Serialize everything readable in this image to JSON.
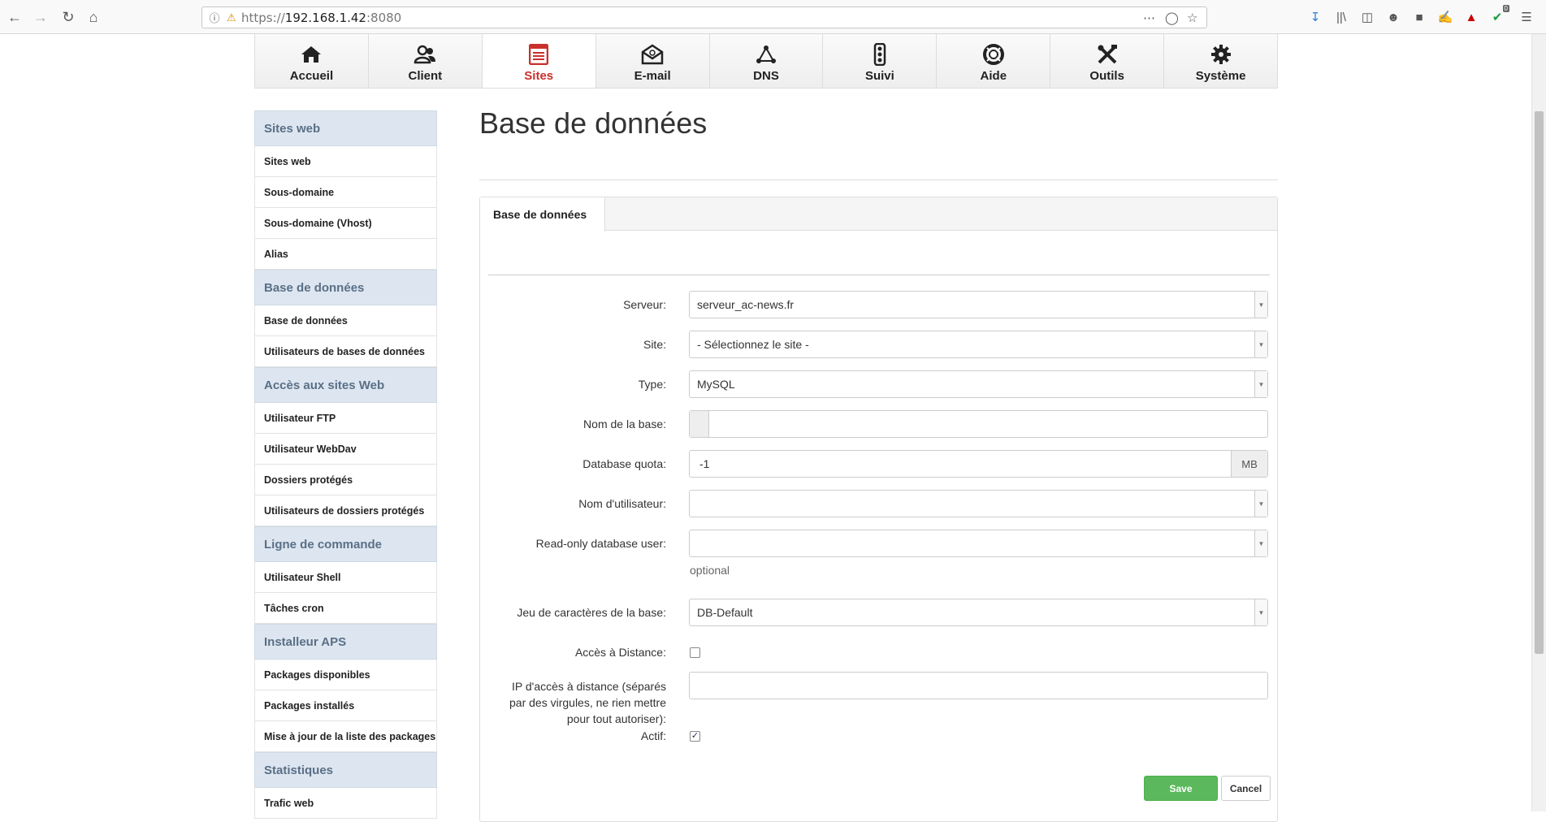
{
  "browser": {
    "url_prefix": "https://",
    "url_host": "192.168.1.42",
    "url_port": ":8080",
    "badge_count": "0"
  },
  "topnav": [
    {
      "label": "Accueil",
      "icon": "home-icon"
    },
    {
      "label": "Client",
      "icon": "users-icon"
    },
    {
      "label": "Sites",
      "icon": "sites-icon",
      "active": true
    },
    {
      "label": "E-mail",
      "icon": "email-icon"
    },
    {
      "label": "DNS",
      "icon": "dns-icon"
    },
    {
      "label": "Suivi",
      "icon": "traffic-light-icon"
    },
    {
      "label": "Aide",
      "icon": "lifebuoy-icon"
    },
    {
      "label": "Outils",
      "icon": "tools-icon"
    },
    {
      "label": "Système",
      "icon": "gear-icon"
    }
  ],
  "sidebar": {
    "sections": [
      {
        "header": "Sites web",
        "items": [
          "Sites web",
          "Sous-domaine",
          "Sous-domaine (Vhost)",
          "Alias"
        ]
      },
      {
        "header": "Base de données",
        "items": [
          "Base de données",
          "Utilisateurs de bases de données"
        ]
      },
      {
        "header": "Accès aux sites Web",
        "items": [
          "Utilisateur FTP",
          "Utilisateur WebDav",
          "Dossiers protégés",
          "Utilisateurs de dossiers protégés"
        ]
      },
      {
        "header": "Ligne de commande",
        "items": [
          "Utilisateur Shell",
          "Tâches cron"
        ]
      },
      {
        "header": "Installeur APS",
        "items": [
          "Packages disponibles",
          "Packages installés",
          "Mise à jour de la liste des packages"
        ]
      },
      {
        "header": "Statistiques",
        "items": [
          "Trafic web"
        ]
      }
    ]
  },
  "main": {
    "title": "Base de données",
    "tab": "Base de données",
    "form": {
      "server_label": "Serveur:",
      "server_value": "serveur_ac-news.fr",
      "site_label": "Site:",
      "site_value": "- Sélectionnez le site -",
      "type_label": "Type:",
      "type_value": "MySQL",
      "dbname_label": "Nom de la base:",
      "dbname_value": "",
      "quota_label": "Database quota:",
      "quota_value": "-1",
      "quota_unit": "MB",
      "user_label": "Nom d'utilisateur:",
      "user_value": "",
      "rouser_label": "Read-only database user:",
      "rouser_value": "",
      "rouser_help": "optional",
      "charset_label": "Jeu de caractères de la base:",
      "charset_value": "DB-Default",
      "remote_label": "Accès à Distance:",
      "remote_checked": false,
      "remote_ips_label": "IP d'accès à distance (séparés par des virgules, ne rien mettre pour tout autoriser):",
      "remote_ips_value": "",
      "active_label": "Actif:",
      "active_checked": true
    },
    "save_label": "Save",
    "cancel_label": "Cancel"
  }
}
